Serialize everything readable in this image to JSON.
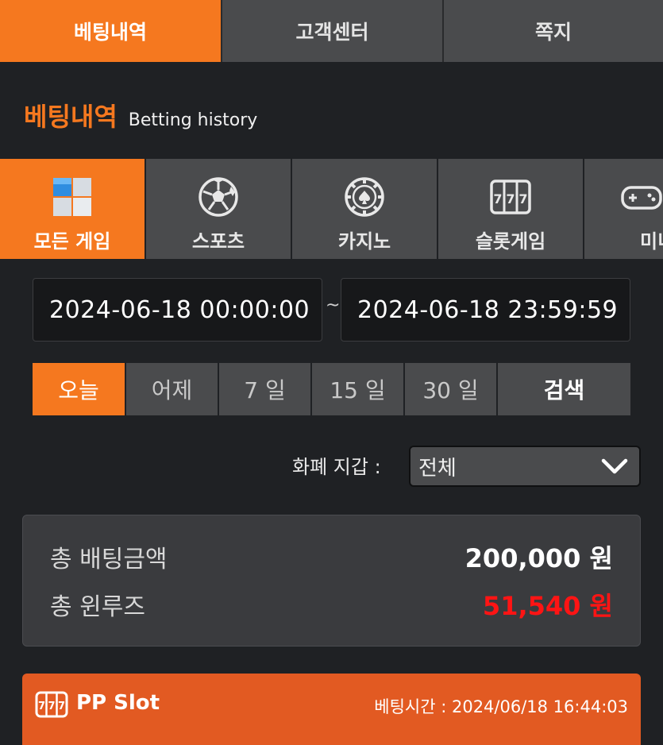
{
  "topnav": {
    "tabs": [
      {
        "label": "베팅내역",
        "active": true
      },
      {
        "label": "고객센터",
        "active": false
      },
      {
        "label": "쪽지",
        "active": false
      }
    ]
  },
  "heading": {
    "title": "베팅내역",
    "subtitle": "Betting history"
  },
  "game_tabs": [
    {
      "label": "모든 게임",
      "icon": "all-games-icon",
      "active": true
    },
    {
      "label": "스포츠",
      "icon": "soccer-ball-icon",
      "active": false
    },
    {
      "label": "카지노",
      "icon": "casino-chip-icon",
      "active": false
    },
    {
      "label": "슬롯게임",
      "icon": "slot-machine-icon",
      "active": false
    },
    {
      "label": "미니",
      "icon": "gamepad-icon",
      "active": false
    }
  ],
  "date_range": {
    "start": "2024-06-18 00:00:00",
    "separator": "~",
    "end": "2024-06-18 23:59:59"
  },
  "quick_filters": [
    {
      "label": "오늘",
      "active": true
    },
    {
      "label": "어제",
      "active": false
    },
    {
      "label": "7 일",
      "active": false
    },
    {
      "label": "15 일",
      "active": false
    },
    {
      "label": "30 일",
      "active": false
    }
  ],
  "search_label": "검색",
  "wallet": {
    "label": "화폐 지갑 :",
    "selected": "전체",
    "icon": "chevron-down-icon"
  },
  "summary": {
    "total_bet_label": "총 배팅금액",
    "total_bet_value": "200,000 원",
    "total_winloss_label": "총 윈루즈",
    "total_winloss_value": "51,540 원"
  },
  "bet_card": {
    "game_name": "PP Slot",
    "bet_time": "베팅시간 : 2024/06/18 16:44:03",
    "icon": "slot-machine-icon"
  },
  "colors": {
    "accent": "#f5781f",
    "negative": "#ff1414",
    "background": "#1f2124",
    "tab": "#4a4b4d"
  }
}
